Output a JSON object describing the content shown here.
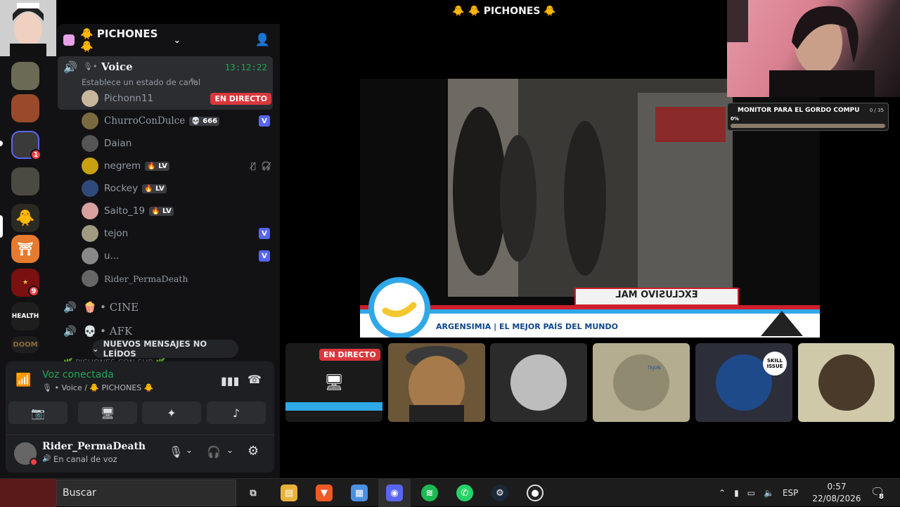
{
  "window": {
    "title": "🐥 🐥 PICHONES 🐥",
    "server_name": "🐥 PICHONES 🐥"
  },
  "server_rail": {
    "badges": [
      "1",
      "9"
    ],
    "health_label": "HEALTH",
    "doom_label": "DOOM"
  },
  "voice_channel": {
    "name": "Voice",
    "status_placeholder": "Establece un estado de canal",
    "timer": "13:12:22",
    "members": [
      {
        "name": "Pichonn11",
        "live": "EN DIRECTO",
        "tag": "",
        "vbadge": ""
      },
      {
        "name": "ChurroConDulce",
        "live": "",
        "tag": "💀 666",
        "vbadge": "V"
      },
      {
        "name": "Daian",
        "live": "",
        "tag": "",
        "vbadge": ""
      },
      {
        "name": "negrem",
        "live": "",
        "tag": "🔥 LV",
        "vbadge": ""
      },
      {
        "name": "Rockey",
        "live": "",
        "tag": "🔥 LV",
        "vbadge": ""
      },
      {
        "name": "Saito_19",
        "live": "",
        "tag": "🔥 LV",
        "vbadge": ""
      },
      {
        "name": "tejon",
        "live": "",
        "tag": "",
        "vbadge": "V"
      },
      {
        "name": "u...",
        "live": "",
        "tag": "",
        "vbadge": "V"
      },
      {
        "name": "Rider_PermaDeath",
        "live": "",
        "tag": "",
        "vbadge": ""
      }
    ]
  },
  "categories": [
    {
      "name": "🍿 • CINE"
    },
    {
      "name": "💀 • AFK"
    }
  ],
  "new_messages": "NUEVOS MENSAJES NO LEÍDOS",
  "next_channel": "🌿 PICHONES CON SUB 🌿",
  "voice_panel": {
    "status": "Voz conectada",
    "location": "🎙 • Voice / 🐥 PICHONES 🐥"
  },
  "user_panel": {
    "username": "Rider_PermaDeath",
    "status": "En canal de voz"
  },
  "stage": {
    "lower_third_text": "ARGENSIMIA | EL MEJOR PAÍS DEL MUNDO",
    "flipped_banner": "EXCLUSIVO MAL"
  },
  "tiles": {
    "live_label": "EN DIRECTO",
    "skill_issue": "SKILL ISSUE",
    "tejon_label": "TEJON"
  },
  "goal": {
    "title": "MONITOR PARA EL GORDO COMPU",
    "count": "0 / 35",
    "progress_label": "0%",
    "progress": 0
  },
  "taskbar": {
    "search_placeholder": "Buscar",
    "language": "ESP",
    "time": "0:57",
    "date": "22/08/2026",
    "notifications": "8"
  }
}
